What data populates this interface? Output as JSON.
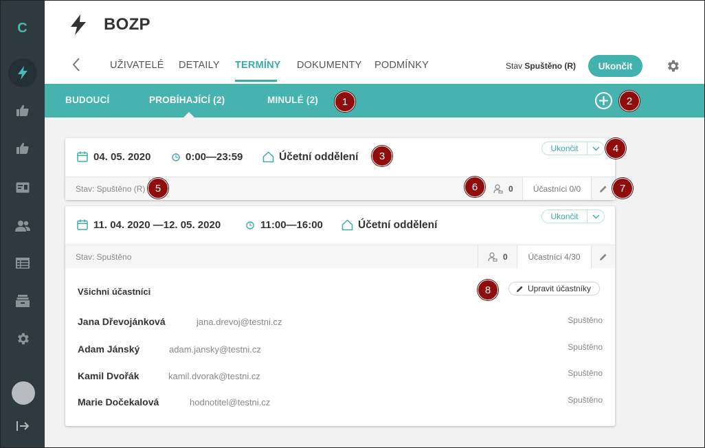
{
  "sidebar": {
    "logo": "C",
    "items": [
      {
        "icon": "lightning-icon",
        "active": true
      },
      {
        "icon": "thumbs-up-icon"
      },
      {
        "icon": "thumbs-up-icon"
      },
      {
        "icon": "id-card-icon"
      },
      {
        "icon": "users-icon"
      },
      {
        "icon": "table-icon"
      },
      {
        "icon": "archive-icon"
      },
      {
        "icon": "gear-icon"
      }
    ],
    "logout_icon": "logout-icon"
  },
  "header": {
    "title": "BOZP",
    "tabs": [
      "UŽIVATELÉ",
      "DETAILY",
      "TERMÍNY",
      "DOKUMENTY",
      "PODMÍNKY"
    ],
    "active_tab": "TERMÍNY",
    "status_label": "Stav",
    "status_value": "Spuštěno (R)",
    "end_button": "Ukončit"
  },
  "subnav": {
    "tabs": [
      "BUDOUCÍ",
      "PROBÍHAJÍCÍ (2)",
      "MINULÉ (2)"
    ],
    "active_tab": "PROBÍHAJÍCÍ (2)"
  },
  "callouts": [
    "1",
    "2",
    "3",
    "4",
    "5",
    "6",
    "7",
    "8"
  ],
  "cards": [
    {
      "date": "04. 05. 2020",
      "time": "0:00—23:59",
      "department": "Účetní oddělení",
      "end_button": "Ukončit",
      "status": "Stav: Spuštěno (R)",
      "count": "0",
      "participants_label": "Účastníci 0/0"
    },
    {
      "date": "11. 04. 2020 —12. 05. 2020",
      "time": "11:00—16:00",
      "department": "Účetní oddělení",
      "end_button": "Ukončit",
      "status": "Stav: Spuštěno",
      "count": "0",
      "participants_label": "Účastníci 4/30",
      "participants_title": "Všichni účastníci",
      "edit_participants": "Upravit účastníky",
      "participants": [
        {
          "name": "Jana Dřevojánková",
          "email": "jana.drevoj@testni.cz",
          "status": "Spuštěno"
        },
        {
          "name": "Adam Jánský",
          "email": "adam.jansky@testni.cz",
          "status": "Spuštěno"
        },
        {
          "name": "Kamil Dvořák",
          "email": "kamil.dvorak@testni.cz",
          "status": "Spuštěno"
        },
        {
          "name": "Marie Dočekalová",
          "email": "hodnotitel@testni.cz",
          "status": "Spuštěno"
        }
      ]
    }
  ],
  "colors": {
    "accent": "#41b2ad",
    "sidebar": "#2f3a3e",
    "callout": "#8f0d0d"
  }
}
